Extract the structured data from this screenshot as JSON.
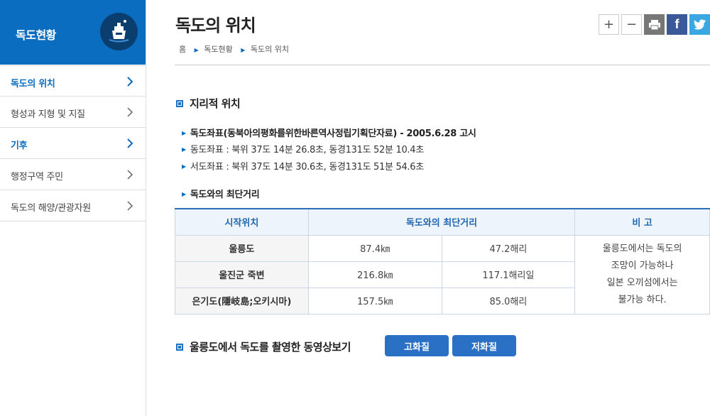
{
  "sidebar": {
    "title": "독도현황",
    "items": [
      {
        "label": "독도의 위치",
        "active": true
      },
      {
        "label": "형성과 지형 및 지질",
        "active": false
      },
      {
        "label": "기후",
        "active": true
      },
      {
        "label": "행정구역 주민",
        "active": false
      },
      {
        "label": "독도의 해양/관광자원",
        "active": false
      }
    ]
  },
  "header": {
    "title": "독도의 위치",
    "breadcrumb": [
      "홈",
      "독도현황",
      "독도의 위치"
    ],
    "tools": {
      "zoom_in": "+",
      "zoom_out": "−",
      "facebook": "f"
    }
  },
  "geo": {
    "heading": "지리적 위치",
    "main_line": "독도좌표(동북아의평화를위한바른역사정립기획단자료) - 2005.6.28 고시",
    "east": "동도좌표 : 북위 37도 14분 26.8초, 동경131도 52분 10.4초",
    "west": "서도좌표 : 북위 37도 14분 30.6초, 동경131도 51분 54.6초",
    "distance_heading": "독도와의 최단거리"
  },
  "table": {
    "headers": [
      "시작위치",
      "독도와의 최단거리",
      "비 고"
    ],
    "rows": [
      {
        "place": "울릉도",
        "km": "87.4㎞",
        "nm": "47.2해리"
      },
      {
        "place": "울진군 죽변",
        "km": "216.8㎞",
        "nm": "117.1해리일"
      },
      {
        "place": "은기도(隱岐島;오키시마)",
        "km": "157.5㎞",
        "nm": "85.0해리"
      }
    ],
    "note_lines": [
      "울릉도에서는 독도의",
      "조망이 가능하나",
      "일본 오끼섬에서는",
      "불가능 하다."
    ]
  },
  "video": {
    "heading": "울릉도에서 독도를 촬영한 동영상보기",
    "high_label": "고화질",
    "low_label": "저화질"
  }
}
